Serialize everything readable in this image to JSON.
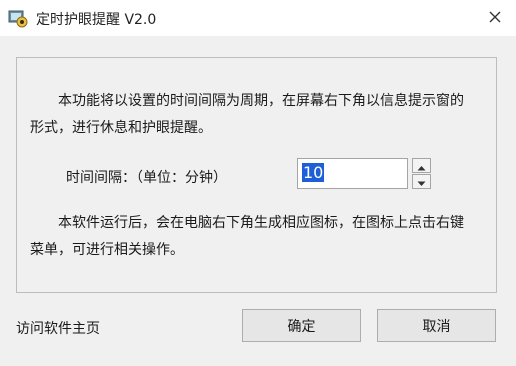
{
  "window": {
    "title": "定时护眼提醒 V2.0"
  },
  "content": {
    "description_1": "本功能将以设置的时间间隔为周期，在屏幕右下角以信息提示窗的形式，进行休息和护眼提醒。",
    "interval_label": "时间间隔：（单位：分钟）",
    "interval_value": "10",
    "description_2": "本软件运行后，会在电脑右下角生成相应图标，在图标上点击右键菜单，可进行相关操作。"
  },
  "footer": {
    "homepage_link": "访问软件主页",
    "ok_label": "确定",
    "cancel_label": "取消"
  },
  "icons": {
    "app": "eye-care-app-icon",
    "close": "close-icon",
    "spin_up": "spin-up-icon",
    "spin_down": "spin-down-icon"
  }
}
